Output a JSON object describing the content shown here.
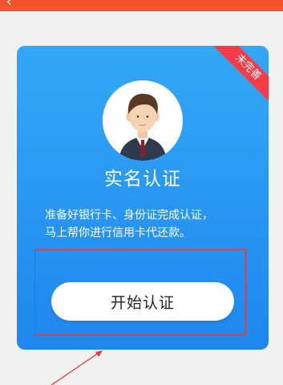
{
  "header": {
    "back_glyph": "‹",
    "title": ""
  },
  "card": {
    "ribbon_label": "未完善",
    "title": "实名认证",
    "description_lines": [
      "准备好银行卡、身份证完成认证，",
      "马上帮你进行信用卡代还款。"
    ],
    "start_button_label": "开始认证"
  },
  "colors": {
    "header_bg": "#f0552c",
    "card_gradient_top": "#33a8f6",
    "card_gradient_bottom": "#1e87ee",
    "ribbon": "#f43b46",
    "annotation_red": "#e03a3a"
  },
  "icons": [
    "back-arrow-icon",
    "user-avatar-icon",
    "annotation-arrow-icon"
  ]
}
